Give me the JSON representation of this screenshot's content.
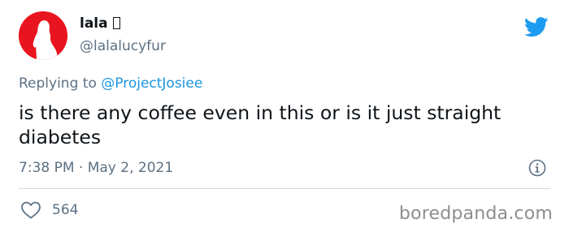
{
  "user": {
    "display_name": "lala",
    "handle": "@lalalucyfur",
    "avatar_icon": "red-silhouette-avatar"
  },
  "reply": {
    "prefix": "Replying to ",
    "mention": "@ProjectJosiee"
  },
  "tweet": {
    "text": "is there any coffee even in this or is it just straight diabetes",
    "timestamp": "7:38 PM · May 2, 2021"
  },
  "actions": {
    "like_icon": "heart-outline-icon",
    "like_count": "564",
    "info_icon": "info-icon"
  },
  "brand": {
    "platform_icon": "twitter-bird-icon",
    "watermark": "boredpanda.com"
  },
  "colors": {
    "accent_blue": "#1d9bf0",
    "muted_text": "#5b7083",
    "avatar_red": "#e8141f",
    "divider": "#cfd9de"
  }
}
